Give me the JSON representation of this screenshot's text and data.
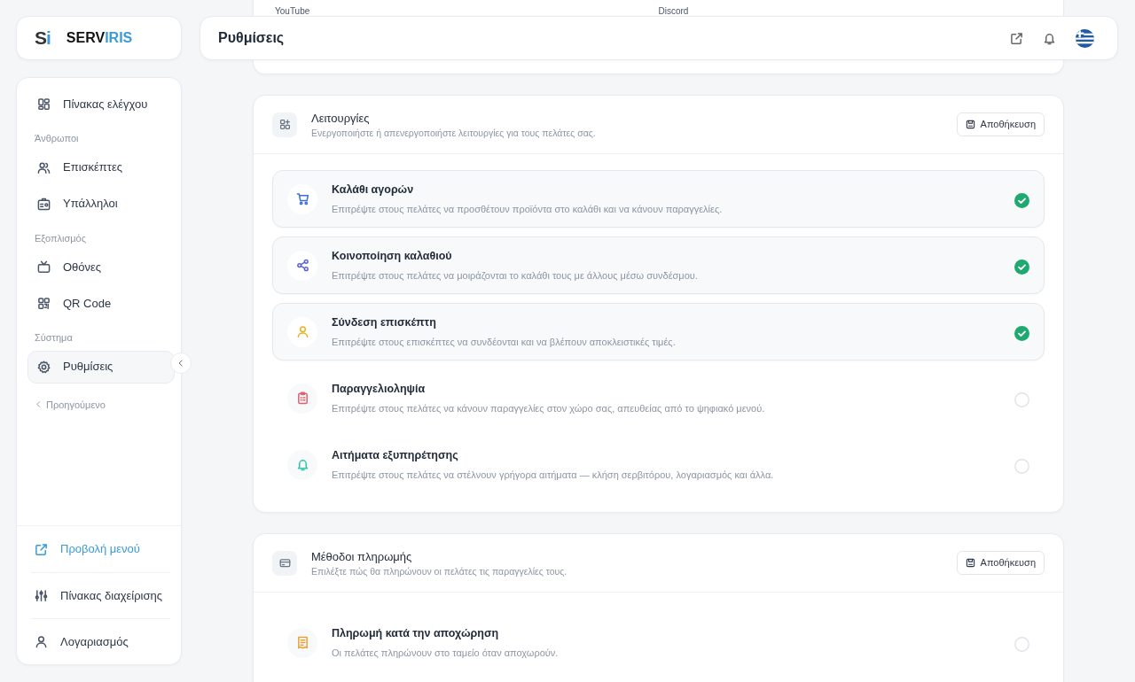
{
  "logo": {
    "mark_left": "S",
    "mark_right": "i",
    "name_left": "SERV",
    "name_right": "IRIS"
  },
  "sidebar": {
    "sections": [
      {
        "items": [
          {
            "label": "Πίνακας ελέγχου",
            "kind": "grid",
            "selected": false
          }
        ]
      },
      {
        "heading": "Άνθρωποι",
        "items": [
          {
            "label": "Επισκέπτες",
            "kind": "users",
            "selected": false
          },
          {
            "label": "Υπάλληλοι",
            "kind": "badge",
            "selected": false
          }
        ]
      },
      {
        "heading": "Εξοπλισμός",
        "items": [
          {
            "label": "Οθόνες",
            "kind": "tv",
            "selected": false
          },
          {
            "label": "QR Code",
            "kind": "qr",
            "selected": false
          }
        ]
      },
      {
        "heading": "Σύστημα",
        "items": [
          {
            "label": "Ρυθμίσεις",
            "kind": "gear",
            "selected": true
          }
        ]
      }
    ],
    "back_link": "Προηγούμενο",
    "footer_items": [
      {
        "label": "Προβολή μενού",
        "kind": "external"
      },
      {
        "label": "Πίνακας διαχείρισης",
        "kind": "sliders"
      },
      {
        "label": "Λογαριασμός",
        "kind": "user"
      }
    ]
  },
  "header": {
    "title": "Ρυθμίσεις"
  },
  "top_card": {
    "labels": [
      "YouTube",
      "Discord"
    ]
  },
  "cards": [
    {
      "kind": "features",
      "title": "Λειτουργίες",
      "subtitle": "Ενεργοποιήστε ή απενεργοποιήστε λειτουργίες για τους πελάτες σας.",
      "button": "Αποθήκευση",
      "items": [
        {
          "kind": "cart",
          "title": "Καλάθι αγορών",
          "description": "Επιτρέψτε στους πελάτες να προσθέτουν προϊόντα στο καλάθι και να κάνουν παραγγελίες.",
          "enabled": true
        },
        {
          "kind": "share",
          "title": "Κοινοποίηση καλαθιού",
          "description": "Επιτρέψτε στους πελάτες να μοιράζονται το καλάθι τους με άλλους μέσω συνδέσμου.",
          "enabled": true
        },
        {
          "kind": "user",
          "title": "Σύνδεση επισκέπτη",
          "description": "Επιτρέψτε στους επισκέπτες να συνδέονται και να βλέπουν αποκλειστικές τιμές.",
          "enabled": true
        },
        {
          "kind": "clipboard",
          "title": "Παραγγελιοληψία",
          "description": "Επιτρέψτε στους πελάτες να κάνουν παραγγελίες στον χώρο σας, απευθείας από το ψηφιακό μενού.",
          "enabled": false
        },
        {
          "kind": "bell",
          "title": "Αιτήματα εξυπηρέτησης",
          "description": "Επιτρέψτε στους πελάτες να στέλνουν γρήγορα αιτήματα — κλήση σερβιτόρου, λογαριασμός και άλλα.",
          "enabled": false
        }
      ]
    },
    {
      "kind": "payment",
      "title": "Μέθοδοι πληρωμής",
      "subtitle": "Επιλέξτε πώς θα πληρώνουν οι πελάτες τις παραγγελίες τους.",
      "button": "Αποθήκευση",
      "items": [
        {
          "kind": "receipt",
          "title": "Πληρωμή κατά την αποχώρηση",
          "description": "Οι πελάτες πληρώνουν στο ταμείο όταν αποχωρούν.",
          "enabled": false
        }
      ]
    }
  ]
}
